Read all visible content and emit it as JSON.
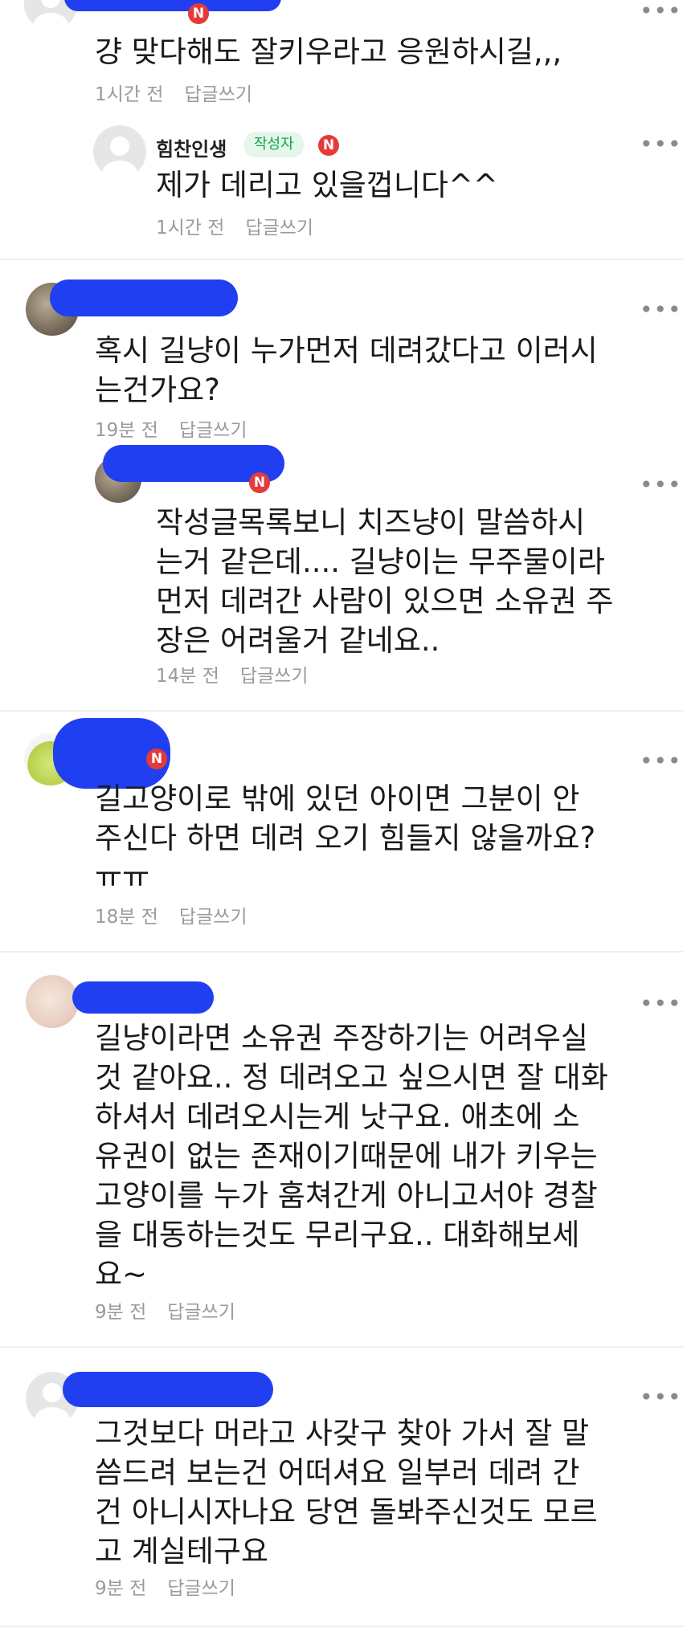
{
  "comments": [
    {
      "text": "걍 맞다해도 잘키우라고 응원하시길,,,",
      "time": "1시간 전",
      "reply": "답글쓰기",
      "badge": "N"
    },
    {
      "username": "힘찬인생",
      "author_tag": "작성자",
      "badge": "N",
      "text": "제가 데리고 있을껍니다^^",
      "time": "1시간 전",
      "reply": "답글쓰기"
    },
    {
      "text": "혹시 길냥이 누가먼저 데려갔다고 이러시\n는건가요?",
      "time": "19분 전",
      "reply": "답글쓰기"
    },
    {
      "badge": "N",
      "text": "작성글목록보니 치즈냥이 말씀하시\n는거 같은데.... 길냥이는 무주물이라\n먼저 데려간 사람이 있으면 소유권 주\n장은 어려울거 같네요..",
      "time": "14분 전",
      "reply": "답글쓰기"
    },
    {
      "badge": "N",
      "text": "길고양이로 밖에 있던 아이면 그분이 안\n주신다 하면 데려 오기 힘들지 않을까요?\nㅠㅠ",
      "time": "18분 전",
      "reply": "답글쓰기"
    },
    {
      "text": "길냥이라면 소유권 주장하기는 어려우실\n것 같아요.. 정 데려오고 싶으시면 잘 대화\n하셔서 데려오시는게 낫구요. 애초에 소\n유권이 없는 존재이기때문에 내가 키우는\n고양이를 누가 훔쳐간게 아니고서야 경찰\n을 대동하는것도 무리구요.. 대화해보세\n요~",
      "time": "9분 전",
      "reply": "답글쓰기"
    },
    {
      "text": "그것보다 머라고 사갖구 찾아 가서 잘 말\n씀드려 보는건 어떠셔요 일부러 데려 간\n건 아니시자나요 당연 돌봐주신것도 모르\n고 계실테구요",
      "time": "9분 전",
      "reply": "답글쓰기"
    }
  ],
  "more_icon": "more-dots-icon",
  "colors": {
    "redaction": "#1f3ff0",
    "badge": "#e53a3a",
    "author_tag": "#16a34a"
  }
}
